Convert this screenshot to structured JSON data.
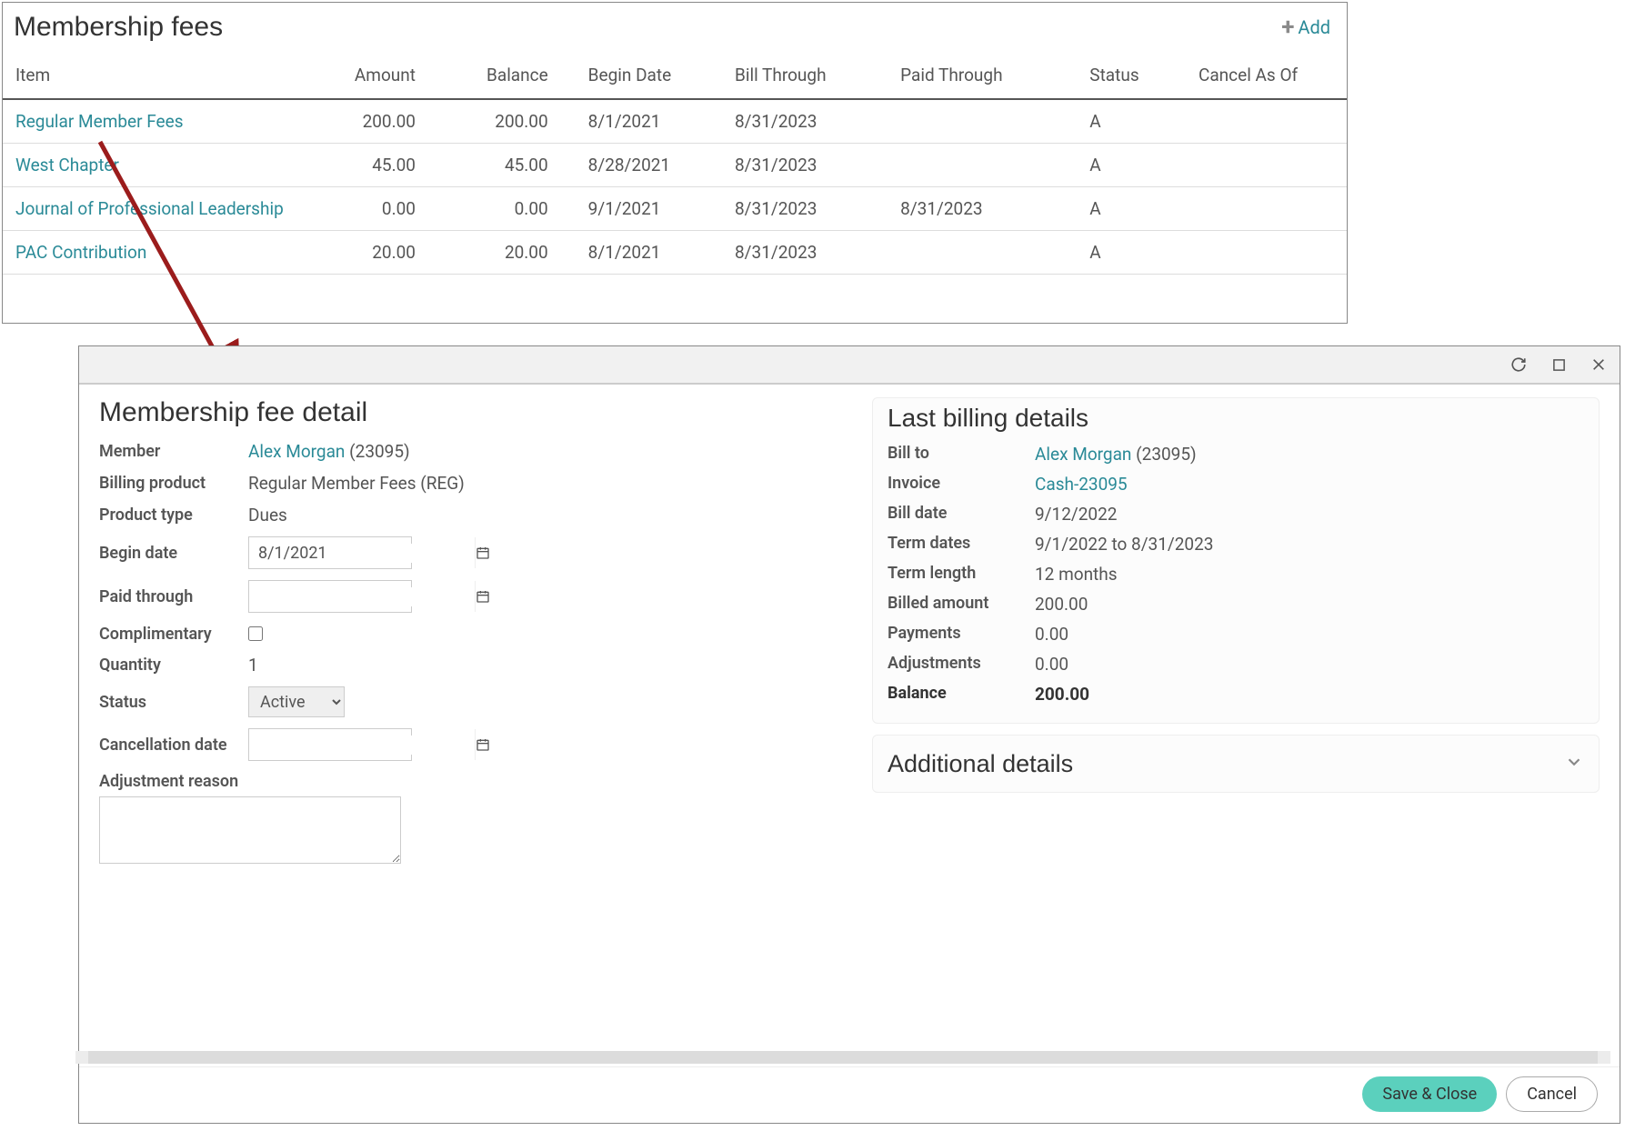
{
  "fees": {
    "title": "Membership fees",
    "add_label": "Add",
    "columns": {
      "item": "Item",
      "amount": "Amount",
      "balance": "Balance",
      "begin": "Begin Date",
      "bill": "Bill Through",
      "paid": "Paid Through",
      "status": "Status",
      "cancel": "Cancel As Of"
    },
    "rows": [
      {
        "item": "Regular Member Fees",
        "amount": "200.00",
        "balance": "200.00",
        "begin": "8/1/2021",
        "bill": "8/31/2023",
        "paid": "",
        "status": "A",
        "cancel": ""
      },
      {
        "item": "West Chapter",
        "amount": "45.00",
        "balance": "45.00",
        "begin": "8/28/2021",
        "bill": "8/31/2023",
        "paid": "",
        "status": "A",
        "cancel": ""
      },
      {
        "item": "Journal of Professional Leadership",
        "amount": "0.00",
        "balance": "0.00",
        "begin": "9/1/2021",
        "bill": "8/31/2023",
        "paid": "8/31/2023",
        "status": "A",
        "cancel": ""
      },
      {
        "item": "PAC Contribution",
        "amount": "20.00",
        "balance": "20.00",
        "begin": "8/1/2021",
        "bill": "8/31/2023",
        "paid": "",
        "status": "A",
        "cancel": ""
      }
    ]
  },
  "detail": {
    "title": "Membership fee detail",
    "member_label": "Member",
    "member_name": "Alex Morgan",
    "member_id_text": " (23095)",
    "billing_product_label": "Billing product",
    "billing_product": "Regular Member Fees (REG)",
    "product_type_label": "Product type",
    "product_type": "Dues",
    "begin_date_label": "Begin date",
    "begin_date": "8/1/2021",
    "paid_through_label": "Paid through",
    "paid_through": "",
    "complimentary_label": "Complimentary",
    "complimentary": false,
    "quantity_label": "Quantity",
    "quantity": "1",
    "status_label": "Status",
    "status_value": "Active",
    "cancellation_date_label": "Cancellation date",
    "cancellation_date": "",
    "adjustment_reason_label": "Adjustment reason",
    "adjustment_reason": ""
  },
  "billing": {
    "title": "Last billing details",
    "bill_to_label": "Bill to",
    "bill_to_name": "Alex Morgan",
    "bill_to_id_text": " (23095)",
    "invoice_label": "Invoice",
    "invoice": "Cash-23095",
    "bill_date_label": "Bill date",
    "bill_date": "9/12/2022",
    "term_dates_label": "Term dates",
    "term_dates": "9/1/2022 to 8/31/2023",
    "term_length_label": "Term length",
    "term_length": "12 months",
    "billed_amount_label": "Billed amount",
    "billed_amount": "200.00",
    "payments_label": "Payments",
    "payments": "0.00",
    "adjustments_label": "Adjustments",
    "adjustments": "0.00",
    "balance_label": "Balance",
    "balance": "200.00"
  },
  "additional": {
    "title": "Additional details"
  },
  "buttons": {
    "save": "Save & Close",
    "cancel": "Cancel"
  }
}
